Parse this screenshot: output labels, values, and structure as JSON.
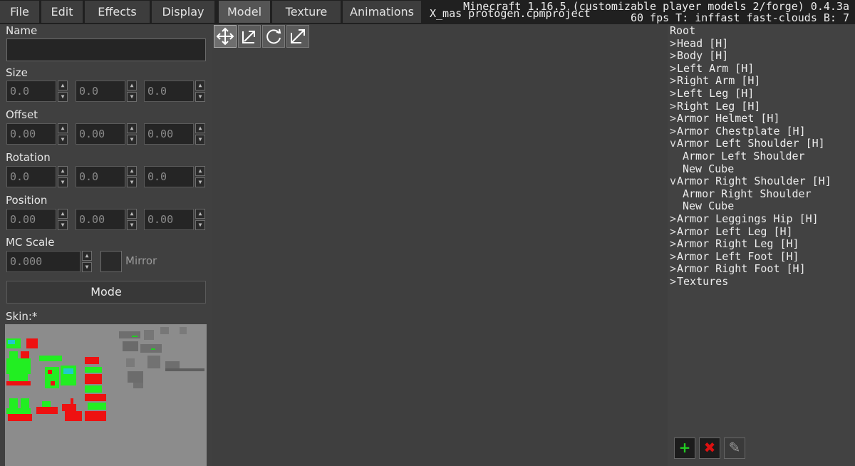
{
  "menu": {
    "tabs": [
      {
        "label": "File"
      },
      {
        "label": "Edit"
      },
      {
        "label": "Effects"
      },
      {
        "label": "Display"
      },
      {
        "label": "Model"
      },
      {
        "label": "Texture"
      },
      {
        "label": "Animations"
      }
    ],
    "active_tab": "Model"
  },
  "project_name": "X_mas protogen.cpmproject",
  "info": {
    "line1": "Minecraft 1.16.5 (customizable player models 2/forge) 0.4.3a",
    "line2": "60 fps T: inffast fast-clouds B: 7"
  },
  "properties": {
    "name_label": "Name",
    "name_value": "",
    "size_label": "Size",
    "size": [
      "0.0",
      "0.0",
      "0.0"
    ],
    "offset_label": "Offset",
    "offset": [
      "0.00",
      "0.00",
      "0.00"
    ],
    "rotation_label": "Rotation",
    "rotation": [
      "0.0",
      "0.0",
      "0.0"
    ],
    "position_label": "Position",
    "position": [
      "0.00",
      "0.00",
      "0.00"
    ],
    "mc_scale_label": "MC Scale",
    "mc_scale": "0.000",
    "mirror_label": "Mirror",
    "mode_label": "Mode",
    "skin_label": "Skin:*"
  },
  "gizmos": [
    "move-icon",
    "resize-icon",
    "rotate-icon",
    "scale-icon"
  ],
  "tree": [
    {
      "label": "Root",
      "arrow": "",
      "indent": 0
    },
    {
      "label": "Head [H]",
      "arrow": ">",
      "indent": 1
    },
    {
      "label": "Body [H]",
      "arrow": ">",
      "indent": 1
    },
    {
      "label": "Left Arm [H]",
      "arrow": ">",
      "indent": 1
    },
    {
      "label": "Right Arm [H]",
      "arrow": ">",
      "indent": 1
    },
    {
      "label": "Left Leg [H]",
      "arrow": ">",
      "indent": 1
    },
    {
      "label": "Right Leg [H]",
      "arrow": ">",
      "indent": 1
    },
    {
      "label": "Armor Helmet [H]",
      "arrow": ">",
      "indent": 1
    },
    {
      "label": "Armor Chestplate [H]",
      "arrow": ">",
      "indent": 1
    },
    {
      "label": "Armor Left Shoulder [H]",
      "arrow": "v",
      "indent": 1
    },
    {
      "label": "Armor Left Shoulder",
      "arrow": "",
      "indent": 2
    },
    {
      "label": "New Cube",
      "arrow": "",
      "indent": 2
    },
    {
      "label": "Armor Right Shoulder [H]",
      "arrow": "v",
      "indent": 1
    },
    {
      "label": "Armor Right Shoulder",
      "arrow": "",
      "indent": 2
    },
    {
      "label": "New Cube",
      "arrow": "",
      "indent": 2
    },
    {
      "label": "Armor Leggings Hip [H]",
      "arrow": ">",
      "indent": 1
    },
    {
      "label": "Armor Left Leg [H]",
      "arrow": ">",
      "indent": 1
    },
    {
      "label": "Armor Right Leg [H]",
      "arrow": ">",
      "indent": 1
    },
    {
      "label": "Armor Left Foot [H]",
      "arrow": ">",
      "indent": 1
    },
    {
      "label": "Armor Right Foot [H]",
      "arrow": ">",
      "indent": 1
    },
    {
      "label": "Textures",
      "arrow": ">",
      "indent": 1
    }
  ],
  "tree_tools": {
    "add": "+",
    "delete": "✖",
    "edit": "✎"
  },
  "colors": {
    "green": "#22ee22",
    "red": "#ee1111",
    "dark_red": "#a80d0d",
    "cyan": "#22c8cc",
    "wood": "#b08a56"
  }
}
